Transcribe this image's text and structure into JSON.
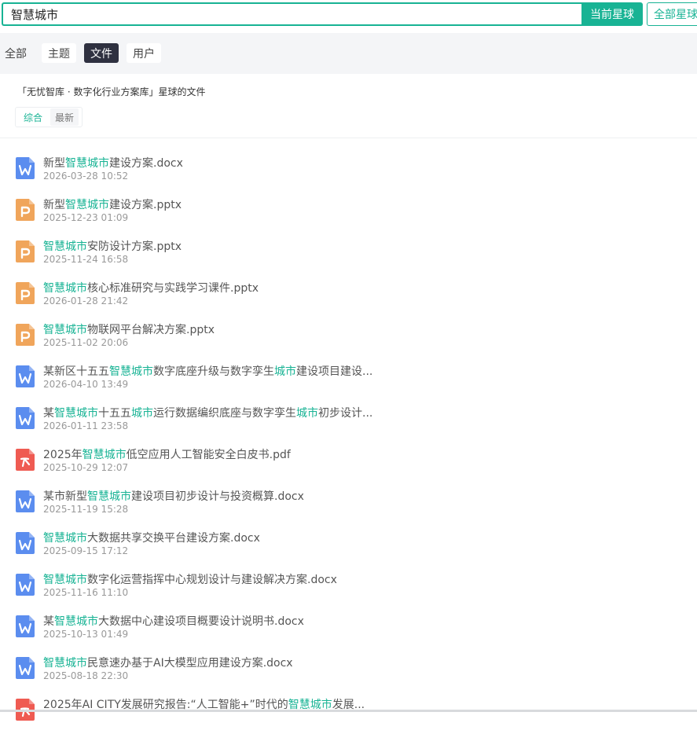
{
  "search": {
    "value": "智慧城市",
    "current_btn": "当前星球",
    "all_btn": "全部星球"
  },
  "tabs": [
    {
      "label": "全部",
      "active": false
    },
    {
      "label": "主题",
      "active": false
    },
    {
      "label": "文件",
      "active": true
    },
    {
      "label": "用户",
      "active": false
    }
  ],
  "scope_title": "「无忧智库 · 数字化行业方案库」星球的文件",
  "sort": {
    "comprehensive": "综合",
    "latest": "最新"
  },
  "colors": {
    "accent": "#18b394",
    "word": "#5b8def",
    "ppt": "#f0a55b",
    "pdf": "#ef5b52"
  },
  "files": [
    {
      "type": "word",
      "parts": [
        "新型",
        "智慧城市",
        "建设方案.docx"
      ],
      "date": "2026-03-28 10:52"
    },
    {
      "type": "ppt",
      "parts": [
        "新型",
        "智慧城市",
        "建设方案.pptx"
      ],
      "date": "2025-12-23 01:09"
    },
    {
      "type": "ppt",
      "parts": [
        "",
        "智慧城市",
        "安防设计方案.pptx"
      ],
      "date": "2025-11-24 16:58"
    },
    {
      "type": "ppt",
      "parts": [
        "",
        "智慧城市",
        "核心标准研究与实践学习课件.pptx"
      ],
      "date": "2026-01-28 21:42"
    },
    {
      "type": "ppt",
      "parts": [
        "",
        "智慧城市",
        "物联网平台解决方案.pptx"
      ],
      "date": "2025-11-02 20:06"
    },
    {
      "type": "word",
      "parts": [
        "某新区十五五",
        "智慧城市",
        "数字底座升级与数字孪生",
        "城市",
        "建设项目建设..."
      ],
      "date": "2026-04-10 13:49"
    },
    {
      "type": "word",
      "parts": [
        "某",
        "智慧城市",
        "十五五",
        "城市",
        "运行数据编织底座与数字孪生",
        "城市",
        "初步设计..."
      ],
      "date": "2026-01-11 23:58"
    },
    {
      "type": "pdf",
      "parts": [
        "2025年",
        "智慧城市",
        "低空应用人工智能安全白皮书.pdf"
      ],
      "date": "2025-10-29 12:07"
    },
    {
      "type": "word",
      "parts": [
        "某市新型",
        "智慧城市",
        "建设项目初步设计与投资概算.docx"
      ],
      "date": "2025-11-19 15:28"
    },
    {
      "type": "word",
      "parts": [
        "",
        "智慧城市",
        "大数据共享交换平台建设方案.docx"
      ],
      "date": "2025-09-15 17:12"
    },
    {
      "type": "word",
      "parts": [
        "",
        "智慧城市",
        "数字化运营指挥中心规划设计与建设解决方案.docx"
      ],
      "date": "2025-11-16 11:10"
    },
    {
      "type": "word",
      "parts": [
        "某",
        "智慧城市",
        "大数据中心建设项目概要设计说明书.docx"
      ],
      "date": "2025-10-13 01:49"
    },
    {
      "type": "word",
      "parts": [
        "",
        "智慧城市",
        "民意速办基于AI大模型应用建设方案.docx"
      ],
      "date": "2025-08-18 22:30"
    },
    {
      "type": "pdf",
      "parts": [
        "2025年AI CITY发展研究报告:“人工智能+”时代的",
        "智慧城市",
        "发展..."
      ],
      "date": ""
    }
  ]
}
